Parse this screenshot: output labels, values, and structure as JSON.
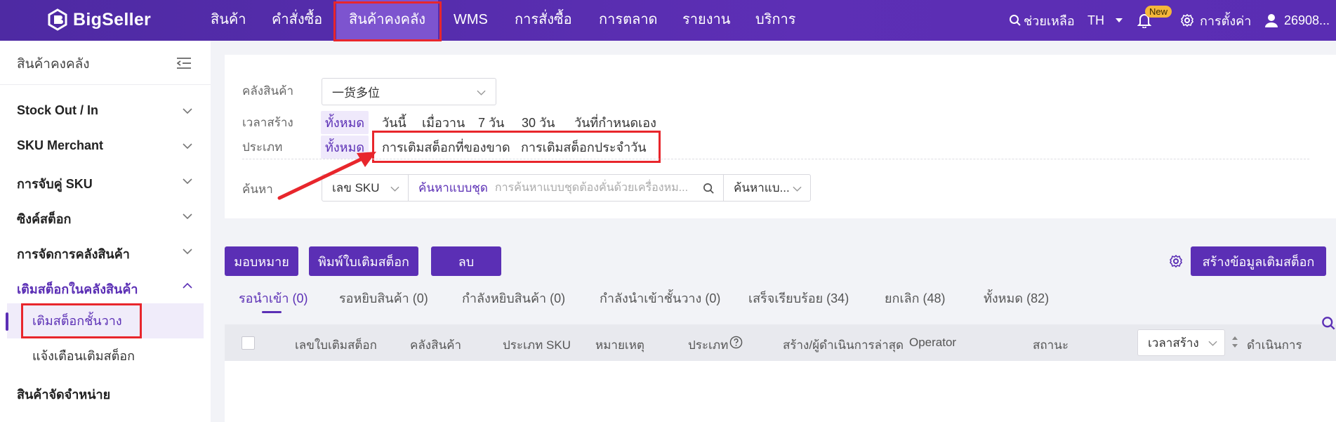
{
  "brand": {
    "name": "BigSeller"
  },
  "nav": {
    "items": [
      "สินค้า",
      "คำสั่งซื้อ",
      "สินค้าคงคลัง",
      "WMS",
      "การสั่งซื้อ",
      "การตลาด",
      "รายงาน",
      "บริการ"
    ],
    "active": "สินค้าคงคลัง"
  },
  "tools": {
    "help": "ช่วยเหลือ",
    "language": "TH",
    "new_badge": "New",
    "settings": "การตั้งค่า",
    "user": "26908..."
  },
  "sidebar": {
    "title": "สินค้าคงคลัง",
    "items": [
      {
        "label": "Stock Out / In"
      },
      {
        "label": "SKU Merchant"
      },
      {
        "label": "การจับคู่ SKU"
      },
      {
        "label": "ซิงค์สต็อก"
      },
      {
        "label": "การจัดการคลังสินค้า"
      },
      {
        "label": "เติมสต็อกในคลังสินค้า",
        "expanded": true
      },
      {
        "label": "สินค้าจัดจำหน่าย"
      }
    ],
    "subitems": [
      "เติมสต็อกชั้นวาง",
      "แจ้งเตือนเติมสต็อก"
    ]
  },
  "filters": {
    "warehouse_label": "คลังสินค้า",
    "warehouse_value": "一货多位",
    "created_label": "เวลาสร้าง",
    "created_options": [
      "ทั้งหมด",
      "วันนี้",
      "เมื่อวาน",
      "7 วัน",
      "30 วัน",
      "วันที่กำหนดเอง"
    ],
    "type_label": "ประเภท",
    "type_options": [
      "ทั้งหมด",
      "การเติมสต็อกที่ของขาด",
      "การเติมสต็อกประจำวัน"
    ],
    "search_label": "ค้นหา",
    "search_field": "เลข SKU",
    "batch_search": "ค้นหาแบบชุด",
    "search_placeholder": "การค้นหาแบบชุดต้องคั่นด้วยเครื่องหม...",
    "search_mode": "ค้นหาแบ..."
  },
  "actions": {
    "assign": "มอบหมาย",
    "print": "พิมพ์ใบเติมสต็อก",
    "delete": "ลบ",
    "create": "สร้างข้อมูลเติมสต็อก"
  },
  "tabs": [
    "รอนำเข้า (0)",
    "รอหยิบสินค้า (0)",
    "กำลังหยิบสินค้า (0)",
    "กำลังนำเข้าชั้นวาง (0)",
    "เสร็จเรียบร้อย (34)",
    "ยกเลิก (48)",
    "ทั้งหมด (82)"
  ],
  "table": {
    "headers": [
      "เลขใบเติมสต็อก",
      "คลังสินค้า",
      "ประเภท SKU",
      "หมายเหตุ",
      "ประเภท",
      "สร้าง/ผู้ดำเนินการล่าสุด",
      "Operator",
      "สถานะ",
      "เวลาสร้าง",
      "ดำเนินการ"
    ]
  },
  "colors": {
    "primary": "#5b2fb5",
    "highlight": "#e8262c"
  }
}
